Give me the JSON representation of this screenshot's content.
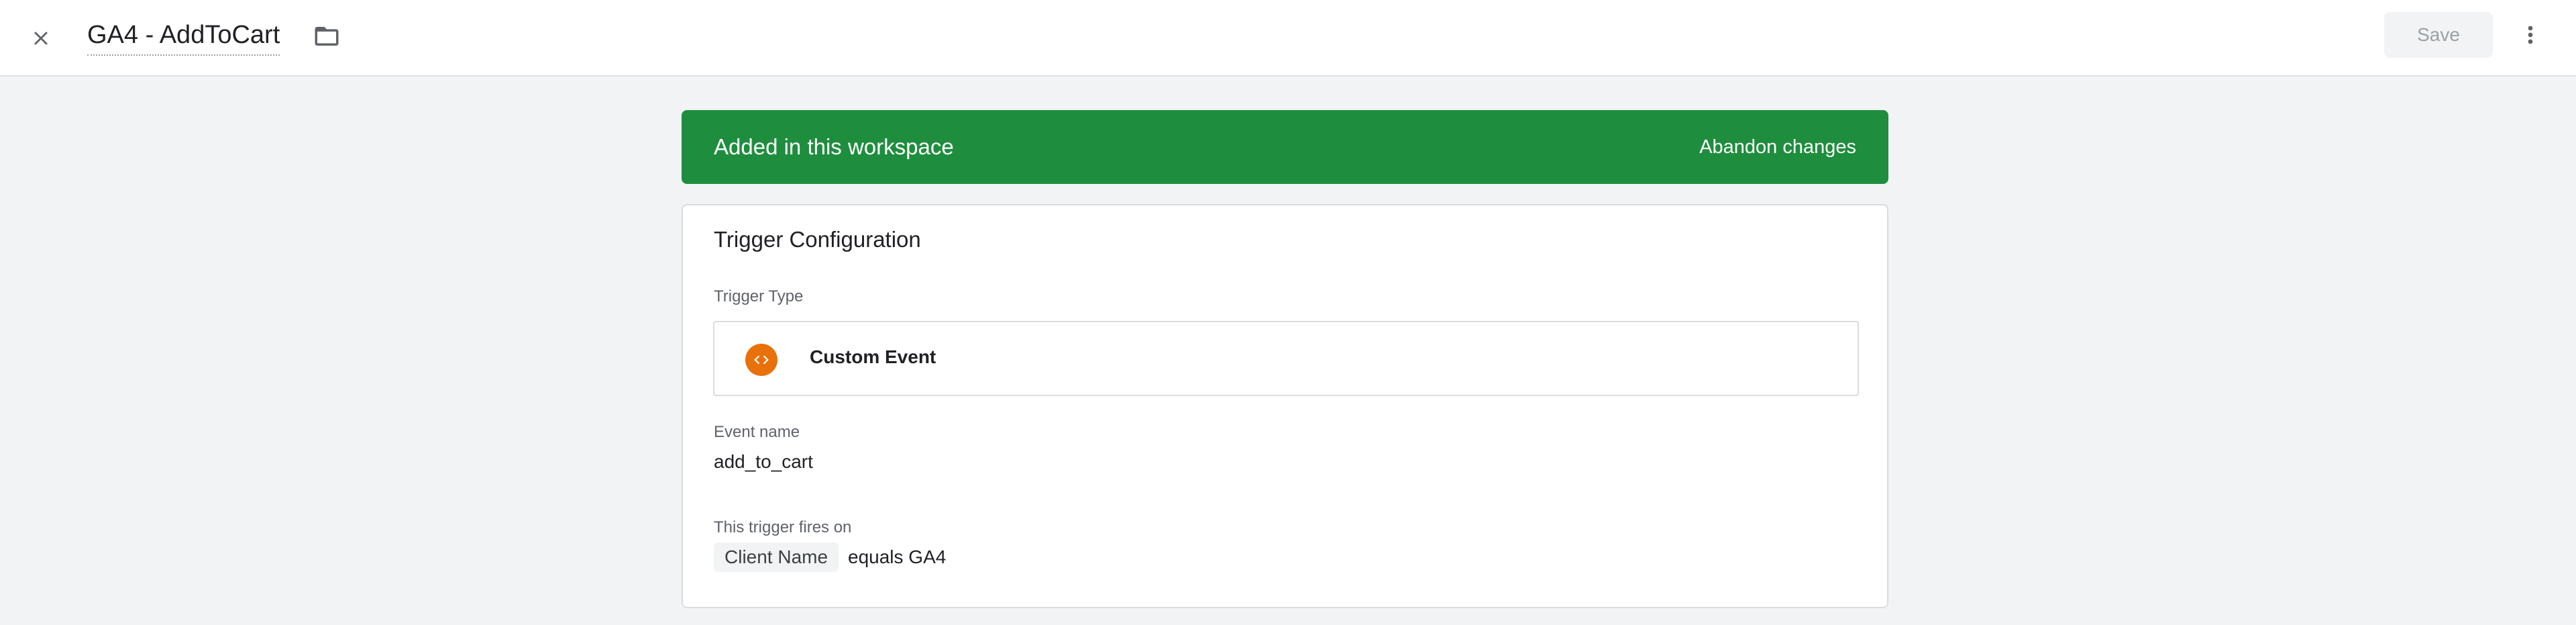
{
  "header": {
    "title": "GA4 - AddToCart",
    "save_label": "Save",
    "icons": {
      "close": "close-icon",
      "folder": "folder-icon",
      "more": "more-vert-icon"
    }
  },
  "banner": {
    "message": "Added in this workspace",
    "action_label": "Abandon changes",
    "color": "#1e8e3e"
  },
  "trigger_config": {
    "title": "Trigger Configuration",
    "type_label": "Trigger Type",
    "type_value": "Custom Event",
    "type_icon": "code-brackets-icon",
    "type_icon_color": "#e8710a",
    "event_name_label": "Event name",
    "event_name_value": "add_to_cart",
    "fires_on_label": "This trigger fires on",
    "condition": {
      "variable": "Client Name",
      "rest": "equals GA4"
    }
  }
}
